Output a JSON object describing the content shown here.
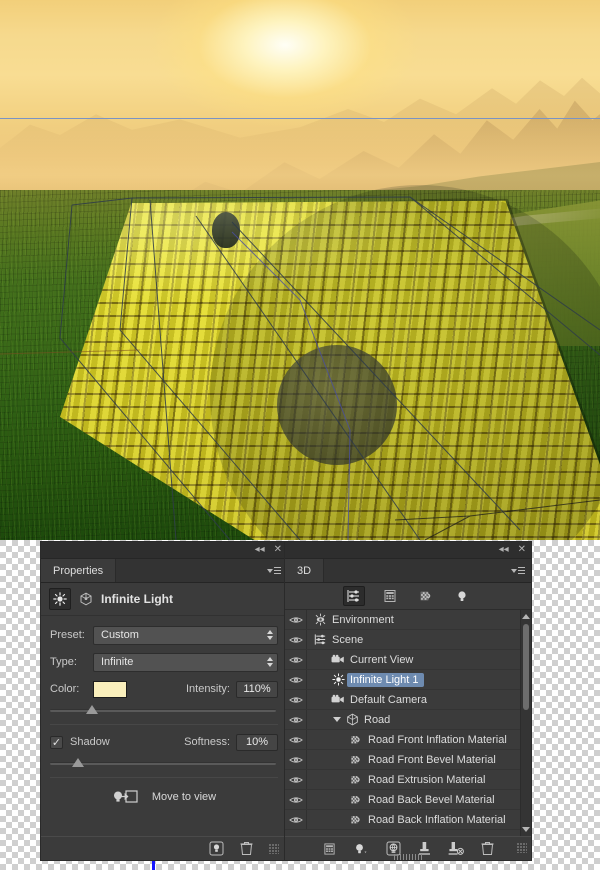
{
  "document": {
    "title": "Yellow brick road 3D composite",
    "guides": {
      "horizontal_label": "horizontal guide",
      "vertical_label": "vertical guide"
    }
  },
  "properties_panel": {
    "tab_label": "Properties",
    "collapse_label": "◂◂",
    "close_label": "✕",
    "header_title": "Infinite Light",
    "rows": {
      "preset_label": "Preset:",
      "preset_value": "Custom",
      "type_label": "Type:",
      "type_value": "Infinite",
      "color_label": "Color:",
      "color_value": "#FAEFBC",
      "intensity_label": "Intensity:",
      "intensity_value": "110%",
      "shadow_label": "Shadow",
      "shadow_checked": "✓",
      "softness_label": "Softness:",
      "softness_value": "10%"
    },
    "move_to_view_label": "Move to view",
    "footer": {
      "add_label": "add-light",
      "delete_label": "delete"
    }
  },
  "threed_panel": {
    "tab_label": "3D",
    "collapse_label": "◂◂",
    "close_label": "✕",
    "toolbar": [
      {
        "name": "scene-filter-icon",
        "label": "Scene",
        "selected": true
      },
      {
        "name": "mesh-filter-icon",
        "label": "Meshes",
        "selected": false
      },
      {
        "name": "materials-filter-icon",
        "label": "Materials",
        "selected": false
      },
      {
        "name": "lights-filter-icon",
        "label": "Lights",
        "selected": false
      }
    ],
    "tree": [
      {
        "label": "Environment",
        "icon": "environment-icon",
        "indent": 0,
        "selected": false,
        "visible": true,
        "disclosure": false
      },
      {
        "label": "Scene",
        "icon": "scene-icon",
        "indent": 0,
        "selected": false,
        "visible": true,
        "disclosure": false
      },
      {
        "label": "Current View",
        "icon": "camera-icon",
        "indent": 1,
        "selected": false,
        "visible": true,
        "disclosure": false
      },
      {
        "label": "Infinite Light 1",
        "icon": "light-icon",
        "indent": 1,
        "selected": true,
        "visible": true,
        "disclosure": false
      },
      {
        "label": "Default Camera",
        "icon": "camera-icon",
        "indent": 1,
        "selected": false,
        "visible": true,
        "disclosure": false
      },
      {
        "label": "Road",
        "icon": "mesh-icon",
        "indent": 1,
        "selected": false,
        "visible": true,
        "disclosure": true
      },
      {
        "label": "Road Front Inflation Material",
        "icon": "material-icon",
        "indent": 2,
        "selected": false,
        "visible": true,
        "disclosure": false
      },
      {
        "label": "Road Front Bevel Material",
        "icon": "material-icon",
        "indent": 2,
        "selected": false,
        "visible": true,
        "disclosure": false
      },
      {
        "label": "Road Extrusion Material",
        "icon": "material-icon",
        "indent": 2,
        "selected": false,
        "visible": true,
        "disclosure": false
      },
      {
        "label": "Road Back Bevel Material",
        "icon": "material-icon",
        "indent": 2,
        "selected": false,
        "visible": true,
        "disclosure": false
      },
      {
        "label": "Road Back Inflation Material",
        "icon": "material-icon",
        "indent": 2,
        "selected": false,
        "visible": true,
        "disclosure": false
      }
    ],
    "footer": [
      {
        "name": "add-mesh-icon",
        "label": "Add Mesh"
      },
      {
        "name": "add-light-icon",
        "label": "Add Light"
      },
      {
        "name": "add-environment-icon",
        "label": "Add Environment"
      },
      {
        "name": "add-point-icon",
        "label": "Add Point"
      },
      {
        "name": "remove-point-icon",
        "label": "Remove Point"
      },
      {
        "name": "delete-icon",
        "label": "Delete"
      }
    ]
  },
  "colors": {
    "panel_bg": "#3b3b3b",
    "panel_dark": "#2e2e2e",
    "selection_blue": "#6e8bb0",
    "light_color": "#FAEFBC",
    "guide_blue": "#7a93c4",
    "road_yellow": "#ded527"
  }
}
